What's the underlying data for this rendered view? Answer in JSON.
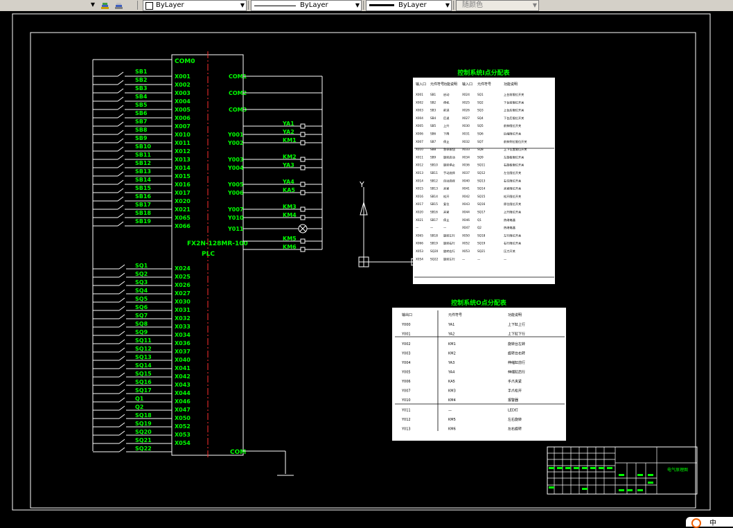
{
  "toolbar": {
    "layer_label": "ByLayer",
    "linetype_label": "ByLayer",
    "lineweight_label": "ByLayer",
    "plotstyle_label": "随颜色"
  },
  "plc": {
    "com_top": "COM0",
    "model": "FX2N-128MR-100",
    "type": "PLC",
    "com_bottom": "COM",
    "inputs_top": [
      "X001",
      "X002",
      "X003",
      "X004",
      "X005",
      "X006",
      "X007",
      "X010",
      "X011",
      "X012",
      "X013",
      "X014",
      "X015",
      "X016",
      "X017",
      "X020",
      "X021",
      "X065",
      "X066"
    ],
    "inputs_bottom": [
      "X024",
      "X025",
      "X026",
      "X027",
      "X030",
      "X031",
      "X032",
      "X033",
      "X034",
      "X036",
      "X037",
      "X040",
      "X041",
      "X042",
      "X043",
      "X044",
      "X046",
      "X047",
      "X050",
      "X052",
      "X053",
      "X054"
    ],
    "switches_top": [
      "SB1",
      "SB2",
      "SB3",
      "SB4",
      "SB5",
      "SB6",
      "SB7",
      "SB8",
      "SB9",
      "SB10",
      "SB11",
      "SB12",
      "SB13",
      "SB14",
      "SB15",
      "SB16",
      "SB17",
      "SB18",
      "SB19"
    ],
    "switches_bottom": [
      "SQ1",
      "SQ2",
      "SQ3",
      "SQ4",
      "SQ5",
      "SQ6",
      "SQ7",
      "SQ8",
      "SQ9",
      "SQ11",
      "SQ12",
      "SQ13",
      "SQ14",
      "SQ15",
      "SQ16",
      "SQ17",
      "Q1",
      "Q2",
      "SQ18",
      "SQ19",
      "SQ20",
      "SQ21",
      "SQ22"
    ],
    "com_outputs": [
      "COM1",
      "COM2",
      "COM3"
    ],
    "outputs": [
      "Y001",
      "Y002",
      "Y003",
      "Y004",
      "Y005",
      "Y006",
      "Y007",
      "Y010",
      "Y011"
    ],
    "loads": [
      "YA1",
      "YA2",
      "KM1",
      "KM2",
      "YA3",
      "YA4",
      "KA5",
      "KM3",
      "KM4",
      "KM5",
      "KM6"
    ]
  },
  "ucs": {
    "y_label": "Y"
  },
  "input_table": {
    "title": "控制系统I点分配表",
    "headers": [
      "输入口",
      "元件符号",
      "功能说明",
      "输入口",
      "元件符号",
      "功能说明"
    ],
    "rows": [
      [
        "X001",
        "SB1",
        "启动",
        "X024",
        "SQ1",
        "上台前限位开关"
      ],
      [
        "X002",
        "SB2",
        "停机",
        "X025",
        "SQ2",
        "下台前限位开关"
      ],
      [
        "X003",
        "SB3",
        "前进",
        "X026",
        "SQ3",
        "上台后限位开关"
      ],
      [
        "X004",
        "SB4",
        "后退",
        "X027",
        "SQ4",
        "下台后限位开关"
      ],
      [
        "X005",
        "SB5",
        "上升",
        "X030",
        "SQ5",
        "前伸限位开关"
      ],
      [
        "X006",
        "SB6",
        "下降",
        "X031",
        "SQ6",
        "后缩限位开关"
      ],
      [
        "X007",
        "SB7",
        "停止",
        "X032",
        "SQ7",
        "前伸到位限位开关"
      ],
      [
        "X010",
        "SB8",
        "急停按钮",
        "X033",
        "SQ8",
        "上下位置限位开关"
      ],
      [
        "X011",
        "SB9",
        "旋转启动",
        "X034",
        "SQ9",
        "左旋极限位开关"
      ],
      [
        "X012",
        "SB10",
        "旋转停止",
        "X036",
        "SQ11",
        "右旋极限位开关"
      ],
      [
        "X013",
        "SB11",
        "手动选择",
        "X037",
        "SQ12",
        "左位限位开关"
      ],
      [
        "X014",
        "SB12",
        "自动选择",
        "X040",
        "SQ13",
        "右位限位开关"
      ],
      [
        "X015",
        "SB13",
        "夹紧",
        "X041",
        "SQ14",
        "夹紧限位开关"
      ],
      [
        "X016",
        "SB14",
        "松开",
        "X042",
        "SQ15",
        "松开限位开关"
      ],
      [
        "X017",
        "SB15",
        "复位",
        "X043",
        "SQ16",
        "原位限位开关"
      ],
      [
        "X020",
        "SB16",
        "夹紧",
        "X044",
        "SQ17",
        "上升限位开关"
      ],
      [
        "X021",
        "SB17",
        "停止",
        "X046",
        "Q1",
        "热继电器"
      ],
      [
        "—",
        "—",
        "—",
        "X047",
        "Q2",
        "热继电器"
      ],
      [
        "X065",
        "SB18",
        "旋转左行",
        "X050",
        "SQ18",
        "左行限位开关"
      ],
      [
        "X066",
        "SB19",
        "旋转右行",
        "X052",
        "SQ19",
        "右行限位开关"
      ],
      [
        "X053",
        "SQ20",
        "旋转右行",
        "X053",
        "SQ21",
        "压力开关"
      ],
      [
        "X054",
        "SQ22",
        "旋转左行",
        "—",
        "—",
        "—"
      ]
    ]
  },
  "output_table": {
    "title": "控制系统O点分配表",
    "headers": [
      "输出口",
      "元件符号",
      "功能说明"
    ],
    "rows": [
      [
        "Y000",
        "YA1",
        "上下缸上行"
      ],
      [
        "Y001",
        "YA2",
        "上下缸下行"
      ],
      [
        "Y002",
        "KM1",
        "旋转台左转"
      ],
      [
        "Y003",
        "KM2",
        "旋转台右转"
      ],
      [
        "Y004",
        "YA3",
        "伸缩缸前行"
      ],
      [
        "Y005",
        "YA4",
        "伸缩缸后行"
      ],
      [
        "Y006",
        "KA5",
        "手爪夹紧"
      ],
      [
        "Y007",
        "KM3",
        "手爪松开"
      ],
      [
        "Y010",
        "KM4",
        "报警器"
      ],
      [
        "Y011",
        "—",
        "LED灯"
      ],
      [
        "Y012",
        "KM5",
        "左右旋转"
      ],
      [
        "Y013",
        "KM6",
        "左右旋转"
      ]
    ]
  },
  "title_block": {
    "drawing_name": "电气原理图"
  },
  "colors": {
    "background": "#000000",
    "text_green": "#00ff00",
    "line_white": "#ffffff",
    "axis_red": "#ff3030"
  }
}
